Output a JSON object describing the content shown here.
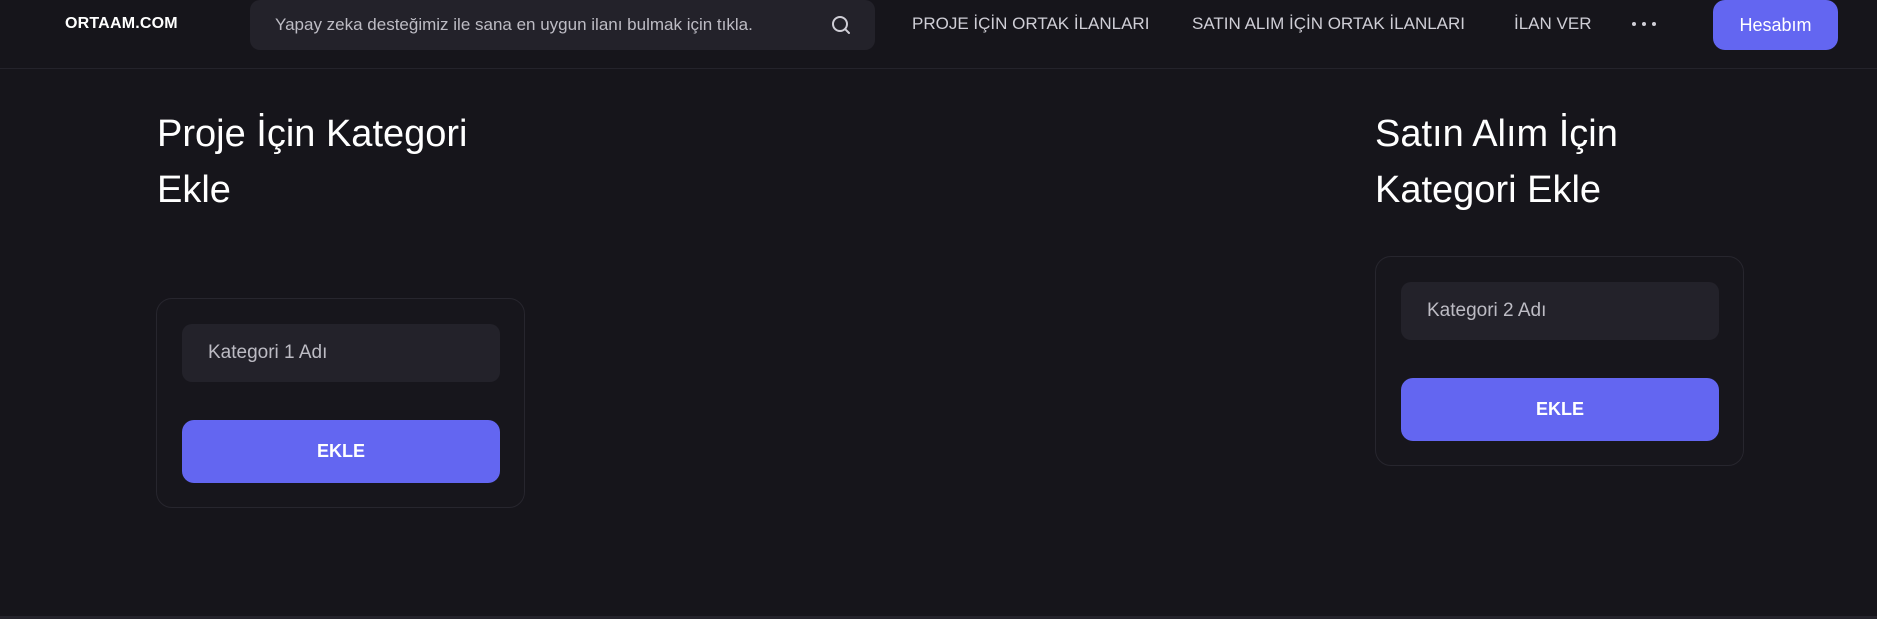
{
  "header": {
    "logo": "ORTAAM.COM",
    "search_placeholder": "Yapay zeka desteğimiz ile sana en uygun ilanı bulmak için tıkla.",
    "nav": [
      {
        "label": "PROJE İÇİN ORTAK İLANLARI"
      },
      {
        "label": "SATIN ALIM İÇİN ORTAK İLANLARI"
      },
      {
        "label": "İLAN VER"
      }
    ],
    "more_icon": "more-horizontal-icon",
    "account_label": "Hesabım"
  },
  "left_section": {
    "title": "Proje İçin Kategori Ekle",
    "input_placeholder": "Kategori 1 Adı",
    "button_label": "EKLE"
  },
  "right_section": {
    "title": "Satın Alım İçin Kategori Ekle",
    "input_placeholder": "Kategori 2 Adı",
    "button_label": "EKLE"
  },
  "colors": {
    "background": "#16151b",
    "surface": "#23222a",
    "accent": "#6366f1",
    "border": "#27262e"
  }
}
